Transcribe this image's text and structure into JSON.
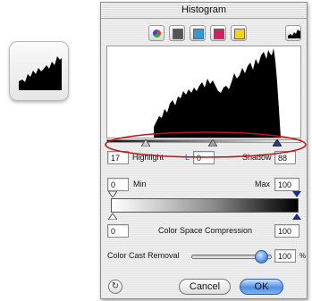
{
  "window": {
    "title": "Histogram"
  },
  "channels": [
    {
      "name": "rgb",
      "color": "#ffffff"
    },
    {
      "name": "gray",
      "color": "#555555"
    },
    {
      "name": "cyan",
      "color": "#2f9bd8"
    },
    {
      "name": "magenta",
      "color": "#d01f63"
    },
    {
      "name": "yellow",
      "color": "#f2d21b"
    }
  ],
  "levels": {
    "highlight_value": "17",
    "highlight_label": "Highlight",
    "l_label": "L",
    "l_value": "0",
    "shadow_label": "Shadow",
    "shadow_value": "88"
  },
  "output": {
    "min_value": "0",
    "min_label": "Min",
    "max_label": "Max",
    "max_value": "100"
  },
  "compression": {
    "left_value": "0",
    "label": "Color Space Compression",
    "right_value": "100"
  },
  "color_cast": {
    "label": "Color Cast Removal",
    "value": "100",
    "unit": "%",
    "slider_level": 0.9
  },
  "buttons": {
    "cancel": "Cancel",
    "ok": "OK"
  },
  "colors": {
    "annotation_oval": "#c0121a",
    "accent_blue": "#4f8ee6"
  }
}
